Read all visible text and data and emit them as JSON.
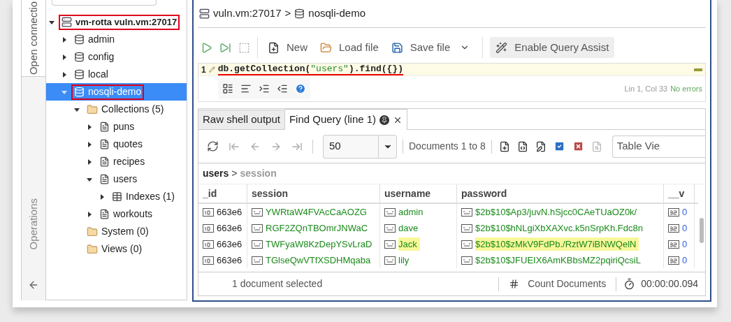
{
  "side_tabs": [
    {
      "label": "Open connectio",
      "selected": true
    },
    {
      "label": "Operations",
      "selected": false
    }
  ],
  "tree": [
    {
      "kind": "server",
      "label": "vm-rotta vuln.vm:27017",
      "expanded": true,
      "selected": false,
      "boxed": true,
      "children": [
        {
          "kind": "database",
          "label": "admin",
          "expanded": false,
          "selected": false,
          "boxed": false
        },
        {
          "kind": "database",
          "label": "config",
          "expanded": false,
          "selected": false,
          "boxed": false
        },
        {
          "kind": "database",
          "label": "local",
          "expanded": false,
          "selected": false,
          "boxed": false
        },
        {
          "kind": "database",
          "label": "nosqli-demo",
          "expanded": true,
          "selected": true,
          "boxed": true,
          "children": [
            {
              "kind": "folder",
              "label": "Collections (5)",
              "expanded": true,
              "selected": false,
              "boxed": false,
              "children": [
                {
                  "kind": "collection",
                  "label": "puns",
                  "expanded": false,
                  "selected": false,
                  "boxed": false
                },
                {
                  "kind": "collection",
                  "label": "quotes",
                  "expanded": false,
                  "selected": false,
                  "boxed": false
                },
                {
                  "kind": "collection",
                  "label": "recipes",
                  "expanded": false,
                  "selected": false,
                  "boxed": false
                },
                {
                  "kind": "collection",
                  "label": "users",
                  "expanded": true,
                  "selected": false,
                  "boxed": false,
                  "children": [
                    {
                      "kind": "indexes",
                      "label": "Indexes (1)",
                      "expanded": false,
                      "selected": false,
                      "boxed": false
                    }
                  ]
                },
                {
                  "kind": "collection",
                  "label": "workouts",
                  "expanded": false,
                  "selected": false,
                  "boxed": false
                }
              ]
            },
            {
              "kind": "folder",
              "label": "System (0)",
              "selected": false,
              "boxed": false
            },
            {
              "kind": "folder",
              "label": "Views (0)",
              "selected": false,
              "boxed": false
            }
          ]
        }
      ]
    }
  ],
  "breadcrumb": {
    "server": "vuln.vm:27017",
    "separator": ">",
    "database": "nosqli-demo"
  },
  "toolbar": {
    "buttons": [
      {
        "kind": "new",
        "label": "New"
      },
      {
        "kind": "load",
        "label": "Load file"
      },
      {
        "kind": "save",
        "label": "Save file"
      }
    ],
    "assist": "Enable Query Assist"
  },
  "editor": {
    "line_number": "1",
    "underlined": true,
    "code": [
      {
        "kind": "code",
        "text": "db.getCollection("
      },
      {
        "kind": "string",
        "text": "\"users\""
      },
      {
        "kind": "code",
        "text": ").find({})"
      }
    ],
    "position": "Lin 1, Col 33",
    "status": "No errors"
  },
  "result_tabs": [
    {
      "label": "Raw shell output",
      "selected": false,
      "closable": false
    },
    {
      "label": "Find Query (line 1)",
      "selected": true,
      "closable": true
    }
  ],
  "results_toolbar": {
    "page_size": "50",
    "range": "Documents 1 to 8",
    "view": "Table Vie"
  },
  "path": {
    "collection": "users",
    "separator": ">",
    "field": "session"
  },
  "table": {
    "columns": [
      "_id",
      "session",
      "username",
      "password",
      "__v"
    ],
    "rows": [
      {
        "cells": [
          {
            "kind": "id",
            "text": "663e6",
            "highlighted": false
          },
          {
            "kind": "string",
            "text": "YWRtaW4FVAcCaAOZG",
            "highlighted": false
          },
          {
            "kind": "string",
            "text": "admin",
            "highlighted": false
          },
          {
            "kind": "string",
            "text": "$2b$10$Ap3/juvN.hSjcc0CAeTUaOZ0k/",
            "highlighted": false
          },
          {
            "kind": "int",
            "text": "0",
            "highlighted": false
          }
        ]
      },
      {
        "cells": [
          {
            "kind": "id",
            "text": "663e6",
            "highlighted": false
          },
          {
            "kind": "string",
            "text": "RGF2ZQnTBOmrJNWaC",
            "highlighted": false
          },
          {
            "kind": "string",
            "text": "dave",
            "highlighted": false
          },
          {
            "kind": "string",
            "text": "$2b$10$hNLgiXbXAXvc.k5nSrpKh.Fdc8n",
            "highlighted": false
          },
          {
            "kind": "int",
            "text": "0",
            "highlighted": false
          }
        ]
      },
      {
        "cells": [
          {
            "kind": "id",
            "text": "663e6",
            "highlighted": false
          },
          {
            "kind": "string",
            "text": "TWFyaW8KzDepYSvLraD",
            "highlighted": false
          },
          {
            "kind": "string",
            "text": "Jack",
            "highlighted": true
          },
          {
            "kind": "string",
            "text": "$2b$10$zMkV9FdPb./RztW7iBNWQelN",
            "highlighted": true
          },
          {
            "kind": "int",
            "text": "0",
            "highlighted": false
          }
        ]
      },
      {
        "cells": [
          {
            "kind": "id",
            "text": "663e6",
            "highlighted": false
          },
          {
            "kind": "string",
            "text": "TGlseQwVTfXSDHMqaba",
            "highlighted": false
          },
          {
            "kind": "string",
            "text": "lily",
            "highlighted": false
          },
          {
            "kind": "string",
            "text": "$2b$10$JFUEIX6AmKBbsMZ2pqiriQcsiL",
            "highlighted": false
          },
          {
            "kind": "int",
            "text": "0",
            "highlighted": false
          }
        ]
      }
    ]
  },
  "status_bar": {
    "selection": "1 document selected",
    "count": "Count Documents",
    "elapsed": "00:00:00.094"
  }
}
